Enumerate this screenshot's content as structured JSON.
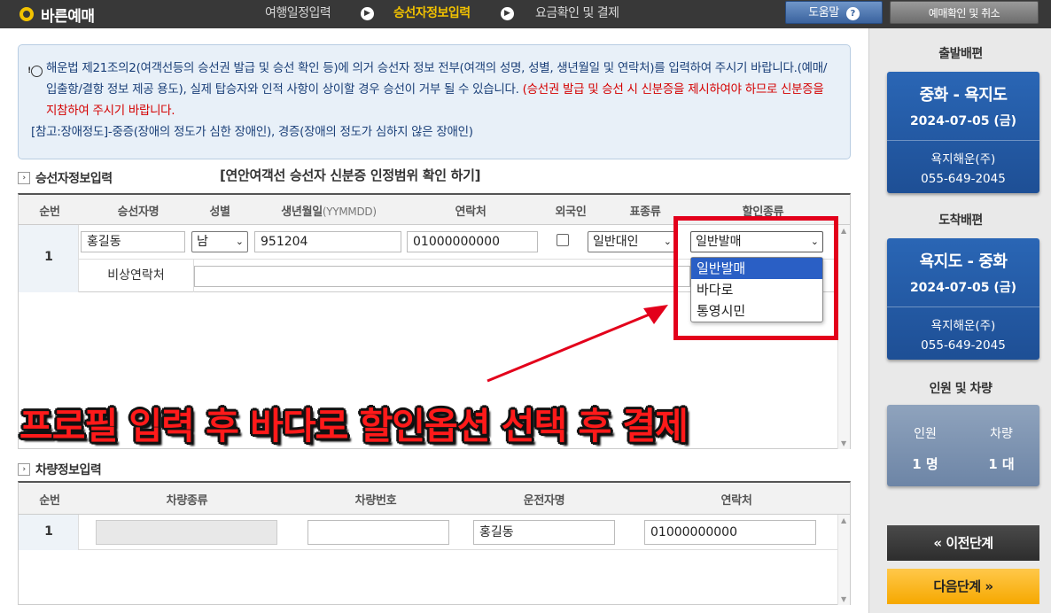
{
  "header": {
    "brand": "바른예매",
    "steps": [
      "여행일정입력",
      "승선자정보입력",
      "요금확인 및 결제"
    ],
    "active_step": "승선자정보입력",
    "help_label": "도움말",
    "cancel_label": "예매확인 및 취소"
  },
  "notice": {
    "line1": "해운법 제21조의2(여객선등의 승선권 발급 및 승선 확인 등)에 의거 승선자 정보 전부(여객의 성명, 성별, 생년월일 및 연락처)를 입력하여 주시기 바랍니다.(예매/입출항/결항 정보 제공 용도), 실제 탑승자와 인적 사항이 상이할 경우 승선이 거부 될 수 있습니다.",
    "line1_red": "(승선권 발급 및 승선 시 신분증을 제시하여야 하므로 신분증을 지참하여 주시기 바랍니다.",
    "line2": "[참고:장애정도]-중증(장애의 정도가 심한 장애인), 경증(장애의 정도가 심하지 않은 장애인)"
  },
  "passenger_section": {
    "title": "승선자정보입력",
    "verify_link": "[연안여객선 승선자 신분증 인정범위 확인 하기]",
    "columns": [
      "순번",
      "승선자명",
      "성별",
      "생년월일",
      "(YYMMDD)",
      "연락처",
      "외국인",
      "표종류",
      "할인종류"
    ],
    "row": {
      "num": "1",
      "name": "홍길동",
      "gender": "남",
      "birth": "951204",
      "phone": "01000000000",
      "foreigner_checked": false,
      "ticket_type": "일반대인",
      "discount_type": "일반발매",
      "emergency_label": "비상연락처",
      "emergency_value": ""
    },
    "discount_options": [
      "일반발매",
      "바다로",
      "통영시민"
    ],
    "discount_highlighted": "일반발매"
  },
  "overlay": {
    "caption": "프로필 입력 후 바다로 할인옵션 선택 후 결제"
  },
  "vehicle_section": {
    "title": "차량정보입력",
    "columns": [
      "순번",
      "차량종류",
      "차량번호",
      "운전자명",
      "연락처"
    ],
    "row": {
      "num": "1",
      "vehicle_type": "",
      "vehicle_number": "",
      "driver": "홍길동",
      "phone": "01000000000"
    }
  },
  "sidebar": {
    "departure_heading": "출발배편",
    "departure": {
      "route": "중화 - 욕지도",
      "date": "2024-07-05 (금)",
      "company": "욕지해운(주)",
      "tel": "055-649-2045"
    },
    "arrival_heading": "도착배편",
    "arrival": {
      "route": "욕지도 - 중화",
      "date": "2024-07-05 (금)",
      "company": "욕지해운(주)",
      "tel": "055-649-2045"
    },
    "pax_heading": "인원 및 차량",
    "pax_label": "인원",
    "pax_value": "1 명",
    "car_label": "차량",
    "car_value": "1 대",
    "prev_label": "이전단계",
    "next_label": "다음단계"
  },
  "colors": {
    "accent_yellow": "#f2c200",
    "card_blue": "#1e4f95",
    "highlight_red": "#e3001b",
    "next_button": "#f6a800"
  }
}
